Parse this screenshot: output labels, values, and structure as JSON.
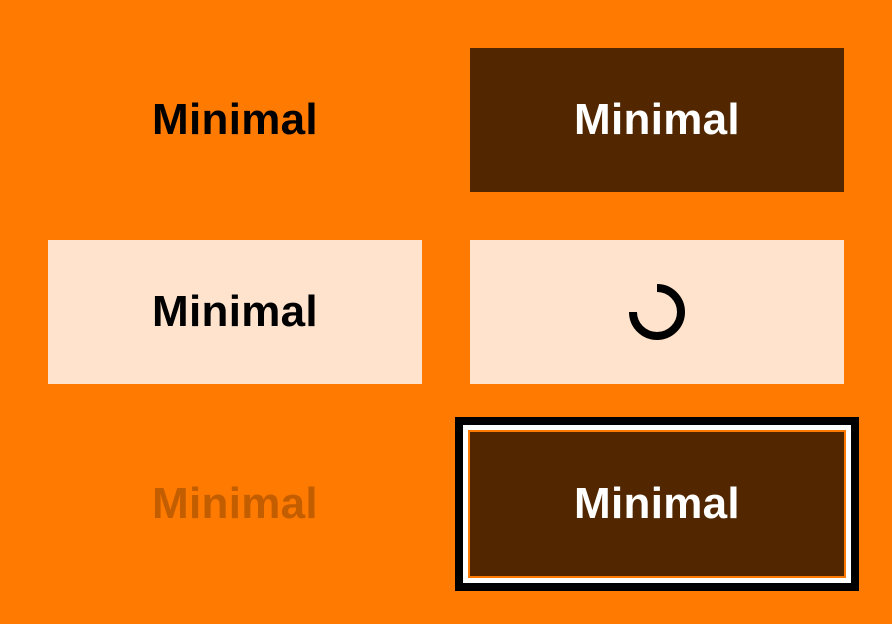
{
  "colors": {
    "background": "#FF7A00",
    "solid_bg": "#522700",
    "pale_bg": "#FFE3CC",
    "disabled_text": "#C25D00"
  },
  "buttons": {
    "ghost_default": {
      "label": "Minimal",
      "state": "default"
    },
    "solid_hover": {
      "label": "Minimal",
      "state": "hover"
    },
    "pale_pressed": {
      "label": "Minimal",
      "state": "pressed"
    },
    "pale_loading": {
      "icon": "spinner-icon",
      "state": "loading"
    },
    "ghost_disabled": {
      "label": "Minimal",
      "state": "disabled"
    },
    "solid_focused": {
      "label": "Minimal",
      "state": "focused"
    }
  }
}
